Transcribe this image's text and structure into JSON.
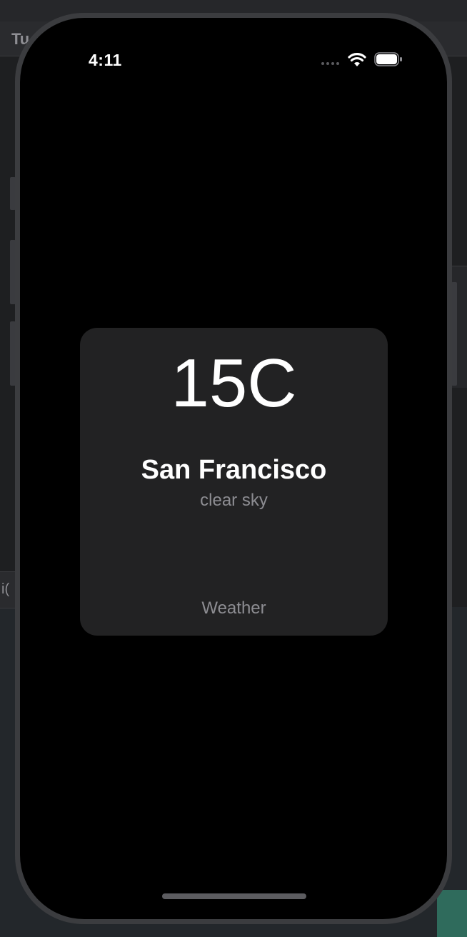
{
  "background": {
    "toolbar_text": "Tu",
    "lower_tag_text": "i("
  },
  "status_bar": {
    "time": "4:11",
    "wifi_icon": "wifi-icon",
    "battery_icon": "battery-icon"
  },
  "widget": {
    "temperature": "15C",
    "city": "San Francisco",
    "description": "clear sky",
    "name": "Weather"
  },
  "colors": {
    "screen": "#000000",
    "widget_bg": "#222223",
    "primary_text": "#ffffff",
    "secondary_text": "#8d8d92"
  }
}
